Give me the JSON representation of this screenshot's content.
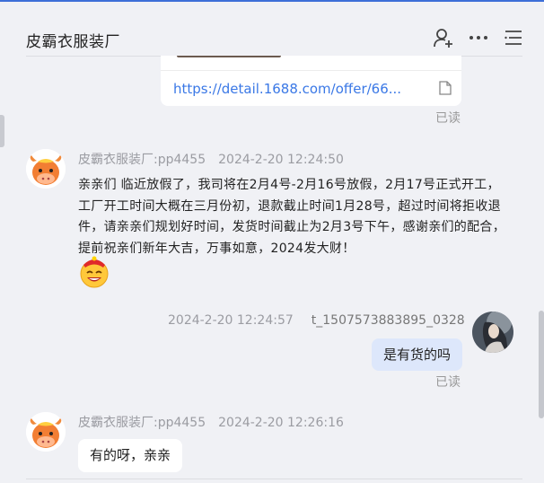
{
  "header": {
    "title": "皮霸衣服装厂"
  },
  "link_card": {
    "url_text": "https://detail.1688.com/offer/66..."
  },
  "messages": [
    {
      "sender": "皮霸衣服装厂:pp4455",
      "time": "2024-2-20 12:24:50",
      "text": "亲亲们 临近放假了，我司将在2月4号-2月16号放假，2月17号正式开工，工厂开工时间大概在三月份初，退款截止时间1月28号，超过时间将拒收退件，请亲亲们规划好时间，发货时间截止为2月3号下午，感谢亲们的配合，提前祝亲们新年大吉，万事如意，2024发大财！"
    },
    {
      "sender": "t_1507573883895_0328",
      "time": "2024-2-20 12:24:57",
      "text": "是有货的吗"
    },
    {
      "sender": "皮霸衣服装厂:pp4455",
      "time": "2024-2-20 12:26:16",
      "text": "有的呀，亲亲"
    }
  ],
  "read_labels": [
    "已读",
    "已读"
  ],
  "icons": {
    "add_contact": "add-contact-icon",
    "more": "more-dots-icon",
    "menu": "menu-lines-icon",
    "doc": "document-icon",
    "emoji": "fortune-emoji-icon"
  },
  "colors": {
    "link": "#3a78e6",
    "bubble_self": "#dde7fb",
    "accent_top": "#3d6fd8"
  }
}
